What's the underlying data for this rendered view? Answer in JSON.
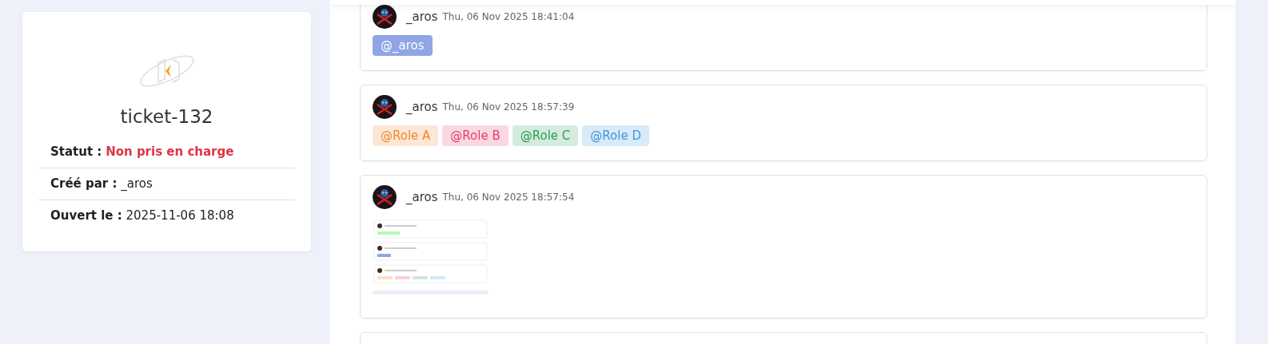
{
  "ticket": {
    "title": "ticket-132",
    "fields": [
      {
        "label": "Statut :",
        "value": "Non pris en charge",
        "kind": "status"
      },
      {
        "label": "Créé par :",
        "value": "_aros",
        "kind": "text"
      },
      {
        "label": "Ouvert le :",
        "value": "2025-11-06 18:08",
        "kind": "text"
      }
    ]
  },
  "messages": [
    {
      "author": "_aros",
      "time": "Thu, 06 Nov 2025 18:41:04",
      "mentions": [
        {
          "text": "@_aros",
          "kind": "user",
          "color": "#8fa5e4"
        }
      ]
    },
    {
      "author": "_aros",
      "time": "Thu, 06 Nov 2025 18:57:39",
      "mentions": [
        {
          "text": "@Role A",
          "kind": "role",
          "color": "#f0892c"
        },
        {
          "text": "@Role B",
          "kind": "role",
          "color": "#e83e6c"
        },
        {
          "text": "@Role C",
          "kind": "role",
          "color": "#2e9a58"
        },
        {
          "text": "@Role D",
          "kind": "role",
          "color": "#3f97dd"
        }
      ]
    },
    {
      "author": "_aros",
      "time": "Thu, 06 Nov 2025 18:57:54",
      "attachment": {
        "kind": "screenshot"
      }
    }
  ]
}
